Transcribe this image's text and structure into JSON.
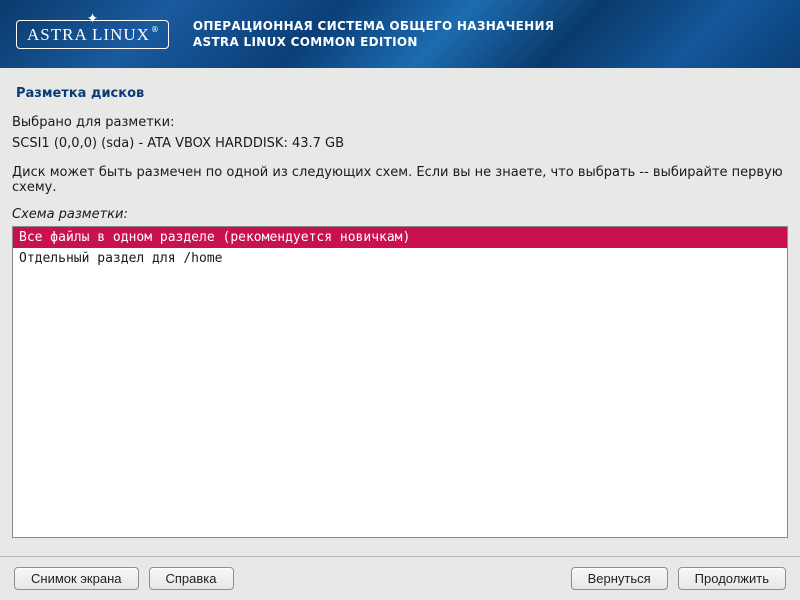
{
  "header": {
    "logo_text": "ASTRA LINUX",
    "title1": "ОПЕРАЦИОННАЯ СИСТЕМА ОБЩЕГО НАЗНАЧЕНИЯ",
    "title2": "ASTRA LINUX COMMON EDITION"
  },
  "page": {
    "title": "Разметка дисков",
    "selected_label": "Выбрано для разметки:",
    "selected_disk": "SCSI1 (0,0,0) (sda) - ATA VBOX HARDDISK: 43.7 GB",
    "hint": "Диск может быть размечен по одной из следующих схем. Если вы не знаете, что выбрать -- выбирайте первую схему.",
    "scheme_label": "Схема разметки:"
  },
  "options": [
    {
      "label": "Все файлы в одном разделе (рекомендуется новичкам)",
      "selected": true
    },
    {
      "label": "Отдельный раздел для /home",
      "selected": false
    }
  ],
  "buttons": {
    "screenshot": "Снимок экрана",
    "help": "Справка",
    "back": "Вернуться",
    "continue": "Продолжить"
  }
}
